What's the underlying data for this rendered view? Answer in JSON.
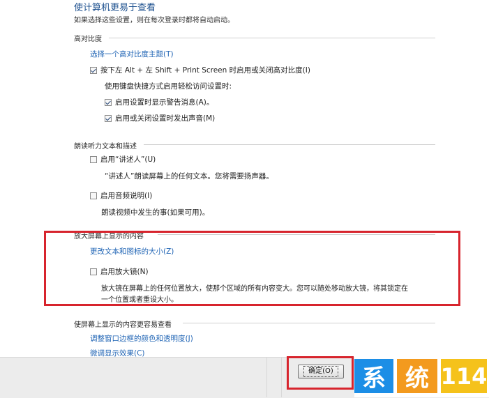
{
  "header": {
    "title": "使计算机更易于查看",
    "subtitle": "如果选择这些设置，则在每次登录时都将自动启动。"
  },
  "sections": {
    "high_contrast": {
      "heading": "高对比度",
      "choose_theme_link": "选择一个高对比度主题(T)",
      "toggle_checkbox": {
        "label": "按下左 Alt + 左 Shift + Print Screen 时启用或关闭高对比度(I)",
        "checked": true
      },
      "keyboard_note": "使用键盘快捷方式启用轻松访问设置时:",
      "warning_checkbox": {
        "label": "启用设置时显示警告消息(A)。",
        "checked": true
      },
      "sound_checkbox": {
        "label": "启用或关闭设置时发出声音(M)",
        "checked": true
      }
    },
    "narration": {
      "heading": "朗读听力文本和描述",
      "narrator_checkbox": {
        "label": "启用“讲述人”(U)",
        "checked": false
      },
      "narrator_desc": "“讲述人”朗读屏幕上的任何文本。您将需要扬声器。",
      "audio_desc_checkbox": {
        "label": "启用音频说明(I)",
        "checked": false
      },
      "audio_desc_text": "朗读视频中发生的事(如果可用)。"
    },
    "magnify": {
      "heading": "放大屏幕上显示的内容",
      "change_size_link": "更改文本和图标的大小(Z)",
      "magnifier_checkbox": {
        "label": "启用放大镜(N)",
        "checked": false
      },
      "magnifier_desc_line1": "放大镜在屏幕上的任何位置放大，使那个区域的所有内容变大。您可以随处移动放大镜，将其锁定在",
      "magnifier_desc_line2": "一个位置或者重设大小。"
    },
    "easier_view": {
      "heading": "使屏幕上显示的内容更容易查看",
      "window_color_link": "调整窗口边框的颜色和透明度(J)",
      "fine_tune_link": "微调显示效果(C)"
    }
  },
  "footer": {
    "ok_label": "确定(O)"
  },
  "watermark": {
    "char1": "系",
    "char2": "统",
    "number": "114",
    "colors": {
      "blue": "#1c8ee6",
      "orange": "#f39a1e",
      "yellow": "#f5c21b"
    }
  },
  "colors": {
    "link": "#1e63b4",
    "highlight_border": "#d7242d",
    "title": "#1b4f8e"
  }
}
